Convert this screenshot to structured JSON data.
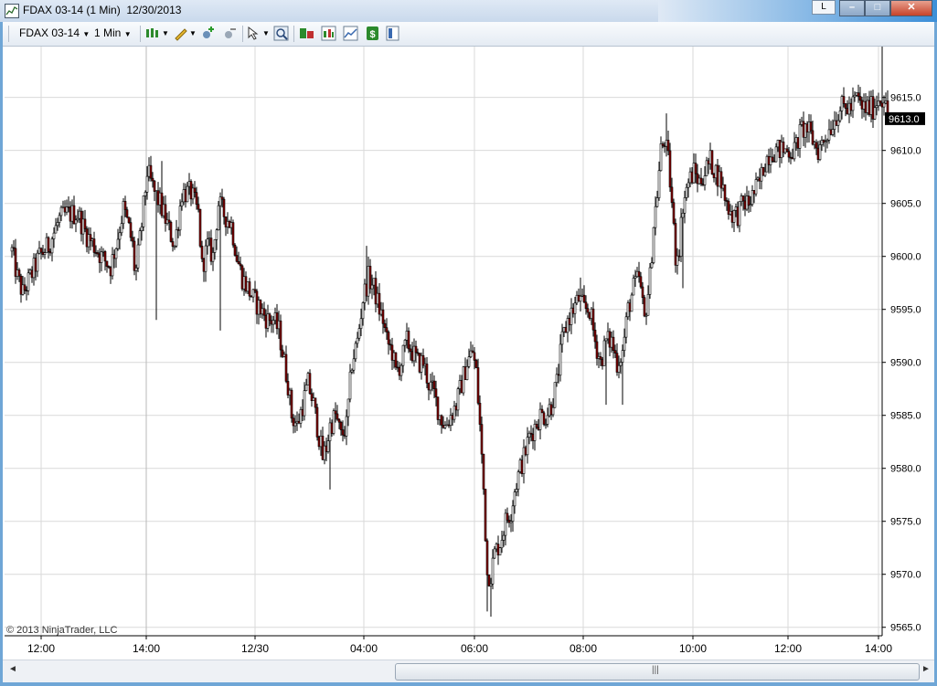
{
  "window": {
    "title": "FDAX 03-14 (1 Min)  12/30/2013",
    "l_button": "L",
    "minimize_glyph": "–",
    "maximize_glyph": "□",
    "close_glyph": "✕"
  },
  "toolbar": {
    "instrument": "FDAX 03-14",
    "interval": "1 Min",
    "icons": [
      "bar-style-icon",
      "pencil-draw-icon",
      "add-indicator-icon",
      "remove-indicator-icon",
      "cursor-select-icon",
      "zoom-icon",
      "data-box-icon",
      "indicators-icon",
      "strategy-icon",
      "money-icon",
      "properties-icon"
    ]
  },
  "chart": {
    "copyright": "© 2013 NinjaTrader, LLC",
    "current_price_label": "9613.0",
    "colors": {
      "up": "#ffffff",
      "down": "#8b0000",
      "outline": "#000000",
      "grid": "#d9d9d9",
      "tag_bg": "#000000"
    },
    "chart_data": {
      "type": "candlestick",
      "instrument": "FDAX 03-14",
      "interval": "1 Min",
      "date": "12/30/2013",
      "y_ticks": [
        9565.0,
        9570.0,
        9575.0,
        9580.0,
        9585.0,
        9590.0,
        9595.0,
        9600.0,
        9605.0,
        9610.0,
        9615.0
      ],
      "y_tick_labels": [
        "9565.0",
        "9570.0",
        "9575.0",
        "9580.0",
        "9585.0",
        "9590.0",
        "9595.0",
        "9600.0",
        "9605.0",
        "9610.0",
        "9615.0"
      ],
      "ylim": [
        9564.2,
        9619.8
      ],
      "x_tick_labels": [
        "12:00",
        "14:00",
        "12/30",
        "04:00",
        "06:00",
        "08:00",
        "10:00",
        "12:00",
        "14:00"
      ],
      "last_price": 9613.0,
      "close_path": [
        [
          0,
          9600.5
        ],
        [
          6,
          9598
        ],
        [
          12,
          9596.5
        ],
        [
          20,
          9598
        ],
        [
          30,
          9600
        ],
        [
          40,
          9601
        ],
        [
          52,
          9603.5
        ],
        [
          60,
          9604
        ],
        [
          72,
          9604
        ],
        [
          82,
          9602
        ],
        [
          90,
          9601
        ],
        [
          98,
          9600
        ],
        [
          108,
          9599
        ],
        [
          115,
          9601.5
        ],
        [
          122,
          9604.5
        ],
        [
          127,
          9603
        ],
        [
          132,
          9601
        ],
        [
          135,
          9598
        ],
        [
          142,
          9603
        ],
        [
          148,
          9608
        ],
        [
          156,
          9606
        ],
        [
          162,
          9605
        ],
        [
          170,
          9603
        ],
        [
          178,
          9601
        ],
        [
          186,
          9606
        ],
        [
          196,
          9606
        ],
        [
          204,
          9604
        ],
        [
          208,
          9599
        ],
        [
          214,
          9601
        ],
        [
          220,
          9600
        ],
        [
          226,
          9605
        ],
        [
          232,
          9604
        ],
        [
          240,
          9603
        ],
        [
          246,
          9600
        ],
        [
          252,
          9598
        ],
        [
          258,
          9597
        ],
        [
          264,
          9596
        ],
        [
          272,
          9595
        ],
        [
          280,
          9594
        ],
        [
          286,
          9594
        ],
        [
          292,
          9593
        ],
        [
          298,
          9590
        ],
        [
          302,
          9588
        ],
        [
          306,
          9585
        ],
        [
          312,
          9584
        ],
        [
          318,
          9586
        ],
        [
          324,
          9588
        ],
        [
          330,
          9586
        ],
        [
          336,
          9583
        ],
        [
          340,
          9581
        ],
        [
          344,
          9582
        ],
        [
          348,
          9584
        ],
        [
          354,
          9585
        ],
        [
          360,
          9583
        ],
        [
          366,
          9584
        ],
        [
          372,
          9590
        ],
        [
          378,
          9592
        ],
        [
          384,
          9596
        ],
        [
          390,
          9598
        ],
        [
          396,
          9597
        ],
        [
          402,
          9595
        ],
        [
          406,
          9594
        ],
        [
          410,
          9592
        ],
        [
          416,
          9591
        ],
        [
          420,
          9589
        ],
        [
          426,
          9590
        ],
        [
          432,
          9592
        ],
        [
          438,
          9591
        ],
        [
          444,
          9590
        ],
        [
          450,
          9590
        ],
        [
          456,
          9588
        ],
        [
          462,
          9587
        ],
        [
          468,
          9585
        ],
        [
          474,
          9584
        ],
        [
          480,
          9585
        ],
        [
          486,
          9586
        ],
        [
          492,
          9588
        ],
        [
          498,
          9590
        ],
        [
          504,
          9591
        ],
        [
          508,
          9589
        ],
        [
          512,
          9584
        ],
        [
          516,
          9578
        ],
        [
          520,
          9570
        ],
        [
          524,
          9570
        ],
        [
          528,
          9572
        ],
        [
          534,
          9573
        ],
        [
          540,
          9575
        ],
        [
          546,
          9576
        ],
        [
          550,
          9578
        ],
        [
          556,
          9580
        ],
        [
          560,
          9581
        ],
        [
          566,
          9583
        ],
        [
          572,
          9584
        ],
        [
          578,
          9585
        ],
        [
          584,
          9585
        ],
        [
          590,
          9586
        ],
        [
          596,
          9588
        ],
        [
          602,
          9592
        ],
        [
          608,
          9594
        ],
        [
          614,
          9595
        ],
        [
          620,
          9596
        ],
        [
          626,
          9595
        ],
        [
          632,
          9595
        ],
        [
          638,
          9592
        ],
        [
          644,
          9590
        ],
        [
          650,
          9592
        ],
        [
          656,
          9592
        ],
        [
          662,
          9590
        ],
        [
          668,
          9591
        ],
        [
          674,
          9595
        ],
        [
          680,
          9597
        ],
        [
          686,
          9598
        ],
        [
          692,
          9594
        ],
        [
          698,
          9598
        ],
        [
          702,
          9603
        ],
        [
          706,
          9606
        ],
        [
          710,
          9610
        ],
        [
          714,
          9611
        ],
        [
          718,
          9609
        ],
        [
          722,
          9605
        ],
        [
          726,
          9600
        ],
        [
          730,
          9601
        ],
        [
          734,
          9605
        ],
        [
          740,
          9607
        ],
        [
          746,
          9608
        ],
        [
          752,
          9607
        ],
        [
          758,
          9608
        ],
        [
          764,
          9609
        ],
        [
          770,
          9608
        ],
        [
          776,
          9607
        ],
        [
          782,
          9605
        ],
        [
          788,
          9604
        ],
        [
          794,
          9604
        ],
        [
          800,
          9605
        ],
        [
          806,
          9605
        ],
        [
          812,
          9606
        ],
        [
          818,
          9607
        ],
        [
          824,
          9609
        ],
        [
          830,
          9610
        ],
        [
          836,
          9610
        ],
        [
          842,
          9610
        ],
        [
          848,
          9610
        ],
        [
          856,
          9610
        ],
        [
          864,
          9612
        ],
        [
          870,
          9612
        ],
        [
          876,
          9611
        ],
        [
          882,
          9610
        ],
        [
          888,
          9611
        ],
        [
          894,
          9612
        ],
        [
          900,
          9613
        ],
        [
          906,
          9614
        ],
        [
          912,
          9614
        ],
        [
          918,
          9614
        ],
        [
          924,
          9615
        ],
        [
          930,
          9614
        ],
        [
          936,
          9614
        ],
        [
          942,
          9614
        ],
        [
          948,
          9615
        ],
        [
          954,
          9615
        ],
        [
          958,
          9613
        ]
      ],
      "spikes": [
        [
          158,
          9594
        ],
        [
          164,
          9609
        ],
        [
          227,
          9593
        ],
        [
          347,
          9578
        ],
        [
          387,
          9601
        ],
        [
          519,
          9566.5
        ],
        [
          524,
          9566
        ],
        [
          622,
          9598
        ],
        [
          649,
          9586
        ],
        [
          668,
          9586
        ],
        [
          716,
          9613.5
        ],
        [
          733,
          9597
        ],
        [
          787,
          9603.5
        ],
        [
          884,
          9609
        ],
        [
          927,
          9616
        ]
      ]
    }
  },
  "scrollbar": {
    "left_arrow": "◄",
    "right_arrow": "►",
    "grip": "|||"
  }
}
